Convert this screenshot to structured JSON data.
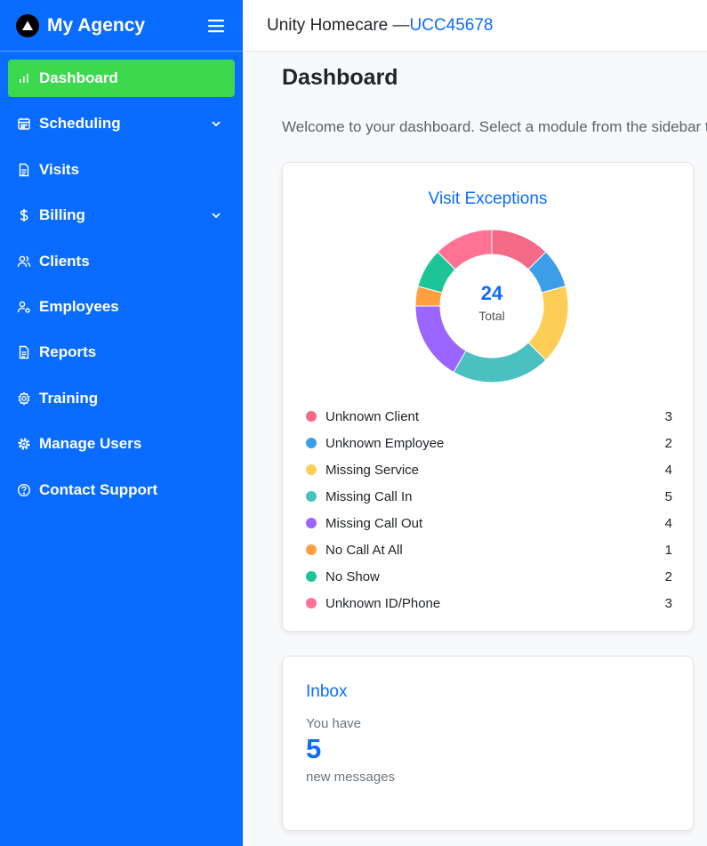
{
  "brand": {
    "title": "My Agency"
  },
  "sidebar": {
    "items": [
      {
        "label": "Dashboard",
        "icon": "bar-chart-icon",
        "active": true
      },
      {
        "label": "Scheduling",
        "icon": "calendar-icon",
        "has_submenu": true
      },
      {
        "label": "Visits",
        "icon": "document-icon"
      },
      {
        "label": "Billing",
        "icon": "dollar-icon",
        "has_submenu": true
      },
      {
        "label": "Clients",
        "icon": "users-icon"
      },
      {
        "label": "Employees",
        "icon": "user-gear-icon"
      },
      {
        "label": "Reports",
        "icon": "report-icon"
      },
      {
        "label": "Training",
        "icon": "gear-icon"
      },
      {
        "label": "Manage Users",
        "icon": "cog-icon"
      },
      {
        "label": "Contact Support",
        "icon": "help-circle-icon"
      }
    ]
  },
  "header": {
    "org_name": "Unity Homecare — ",
    "org_code": "UCC45678"
  },
  "main": {
    "title": "Dashboard",
    "welcome": "Welcome to your dashboard. Select a module from the sidebar to get started."
  },
  "exceptions": {
    "title": "Visit Exceptions",
    "total": "24",
    "total_label": "Total"
  },
  "chart_data": {
    "type": "pie",
    "categories": [
      "Unknown Client",
      "Unknown Employee",
      "Missing Service",
      "Missing Call In",
      "Missing Call Out",
      "No Call At All",
      "No Show",
      "Unknown ID/Phone"
    ],
    "values": [
      3,
      2,
      4,
      5,
      4,
      1,
      2,
      3
    ],
    "colors": [
      "#f56a86",
      "#3d9ee8",
      "#fdcd56",
      "#4bc0c0",
      "#9a66ff",
      "#ff9f40",
      "#1cc497",
      "#ff7294"
    ],
    "title": "Visit Exceptions"
  },
  "inbox": {
    "title": "Inbox",
    "pre": "You have",
    "count": "5",
    "post": "new messages"
  },
  "colors": {
    "sidebar": "#0a6cff",
    "active": "#3cd94e",
    "accent": "#0a6cff"
  }
}
